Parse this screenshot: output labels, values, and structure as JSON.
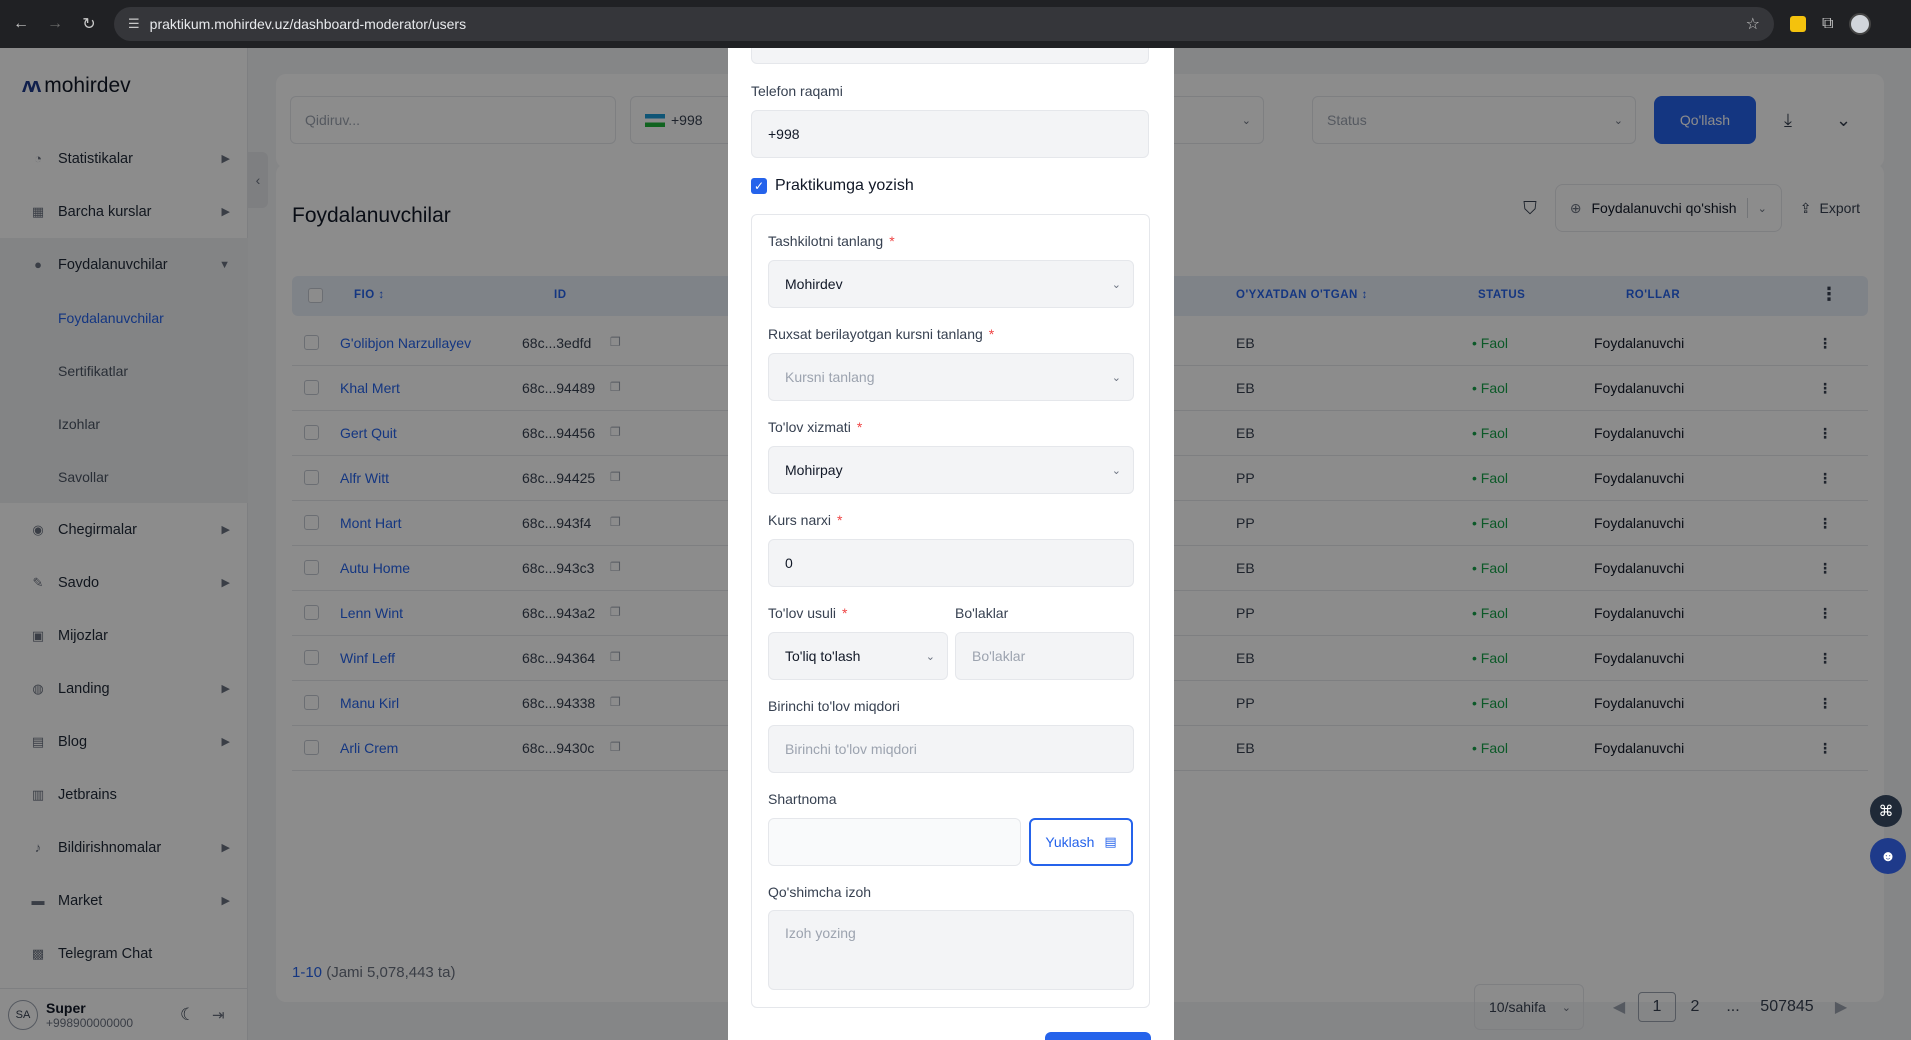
{
  "browser": {
    "url": "praktikum.mohirdev.uz/dashboard-moderator/users"
  },
  "sidebar": {
    "logo": "mohirdev",
    "items": [
      {
        "label": "Statistikalar",
        "icon": "chart-icon",
        "arrow": true
      },
      {
        "label": "Barcha kurslar",
        "icon": "grid-icon",
        "arrow": true
      },
      {
        "label": "Foydalanuvchilar",
        "icon": "users-icon",
        "arrow": true,
        "open": true
      }
    ],
    "subitems": [
      "Foydalanuvchilar",
      "Sertifikatlar",
      "Izohlar",
      "Savollar"
    ],
    "items2": [
      {
        "label": "Chegirmalar",
        "icon": "discount-icon",
        "arrow": true
      },
      {
        "label": "Savdo",
        "icon": "pen-icon",
        "arrow": true
      },
      {
        "label": "Mijozlar",
        "icon": "customers-icon",
        "arrow": false
      },
      {
        "label": "Landing",
        "icon": "landing-icon",
        "arrow": true
      },
      {
        "label": "Blog",
        "icon": "blog-icon",
        "arrow": true
      },
      {
        "label": "Jetbrains",
        "icon": "jetbrains-icon",
        "arrow": false
      },
      {
        "label": "Bildirishnomalar",
        "icon": "bell-icon",
        "arrow": true
      },
      {
        "label": "Market",
        "icon": "market-icon",
        "arrow": true
      },
      {
        "label": "Telegram Chat",
        "icon": "telegram-icon",
        "arrow": false
      }
    ],
    "user": {
      "initials": "SA",
      "name": "Super",
      "phone": "+998900000000"
    }
  },
  "filters": {
    "search_placeholder": "Qidiruv...",
    "phone_prefix": "+998",
    "status_placeholder": "Status",
    "add_button": "Qo'llash"
  },
  "table": {
    "title": "Foydalanuvchilar",
    "add_user": "Foydalanuvchi qo'shish",
    "export": "Export",
    "headers": {
      "fio": "FIO",
      "id": "ID",
      "registered": "O'YXATDAN O'TGAN",
      "status": "STATUS",
      "roles": "RO'LLAR"
    },
    "rows": [
      {
        "name": "G'olibjon Narzullayev",
        "id": "68c...3edfd",
        "reg": "EB",
        "status": "Faol",
        "role": "Foydalanuvchi"
      },
      {
        "name": "Khal Mert",
        "id": "68c...94489",
        "reg": "EB",
        "status": "Faol",
        "role": "Foydalanuvchi"
      },
      {
        "name": "Gert Quit",
        "id": "68c...94456",
        "reg": "EB",
        "status": "Faol",
        "role": "Foydalanuvchi"
      },
      {
        "name": "Alfr Witt",
        "id": "68c...94425",
        "reg": "PP",
        "status": "Faol",
        "role": "Foydalanuvchi"
      },
      {
        "name": "Mont Hart",
        "id": "68c...943f4",
        "reg": "PP",
        "status": "Faol",
        "role": "Foydalanuvchi"
      },
      {
        "name": "Autu Home",
        "id": "68c...943c3",
        "reg": "EB",
        "status": "Faol",
        "role": "Foydalanuvchi"
      },
      {
        "name": "Lenn Wint",
        "id": "68c...943a2",
        "reg": "PP",
        "status": "Faol",
        "role": "Foydalanuvchi"
      },
      {
        "name": "Winf Leff",
        "id": "68c...94364",
        "reg": "EB",
        "status": "Faol",
        "role": "Foydalanuvchi"
      },
      {
        "name": "Manu Kirl",
        "id": "68c...94338",
        "reg": "PP",
        "status": "Faol",
        "role": "Foydalanuvchi"
      },
      {
        "name": "Arli Crem",
        "id": "68c...9430c",
        "reg": "EB",
        "status": "Faol",
        "role": "Foydalanuvchi"
      }
    ],
    "range": "1-10",
    "total": "(Jami 5,078,443 ta)",
    "page_size": "10/sahifa",
    "pages": [
      "1",
      "2",
      "...",
      "507845"
    ]
  },
  "modal": {
    "phone_label": "Telefon raqami",
    "phone_value": "+998",
    "practicum_checkbox": "Praktikumga yozish",
    "org_label": "Tashkilotni tanlang",
    "org_value": "Mohirdev",
    "course_label": "Ruxsat berilayotgan kursni tanlang",
    "course_placeholder": "Kursni tanlang",
    "payment_service_label": "To'lov xizmati",
    "payment_service_value": "Mohirpay",
    "price_label": "Kurs narxi",
    "price_value": "0",
    "payment_method_label": "To'lov usuli",
    "payment_method_value": "To'liq to'lash",
    "parts_label": "Bo'laklar",
    "parts_placeholder": "Bo'laklar",
    "first_payment_label": "Birinchi to'lov miqdori",
    "first_payment_placeholder": "Birinchi to'lov miqdori",
    "contract_label": "Shartnoma",
    "upload_button": "Yuklash",
    "note_label": "Qo'shimcha izoh",
    "note_placeholder": "Izoh yozing"
  }
}
